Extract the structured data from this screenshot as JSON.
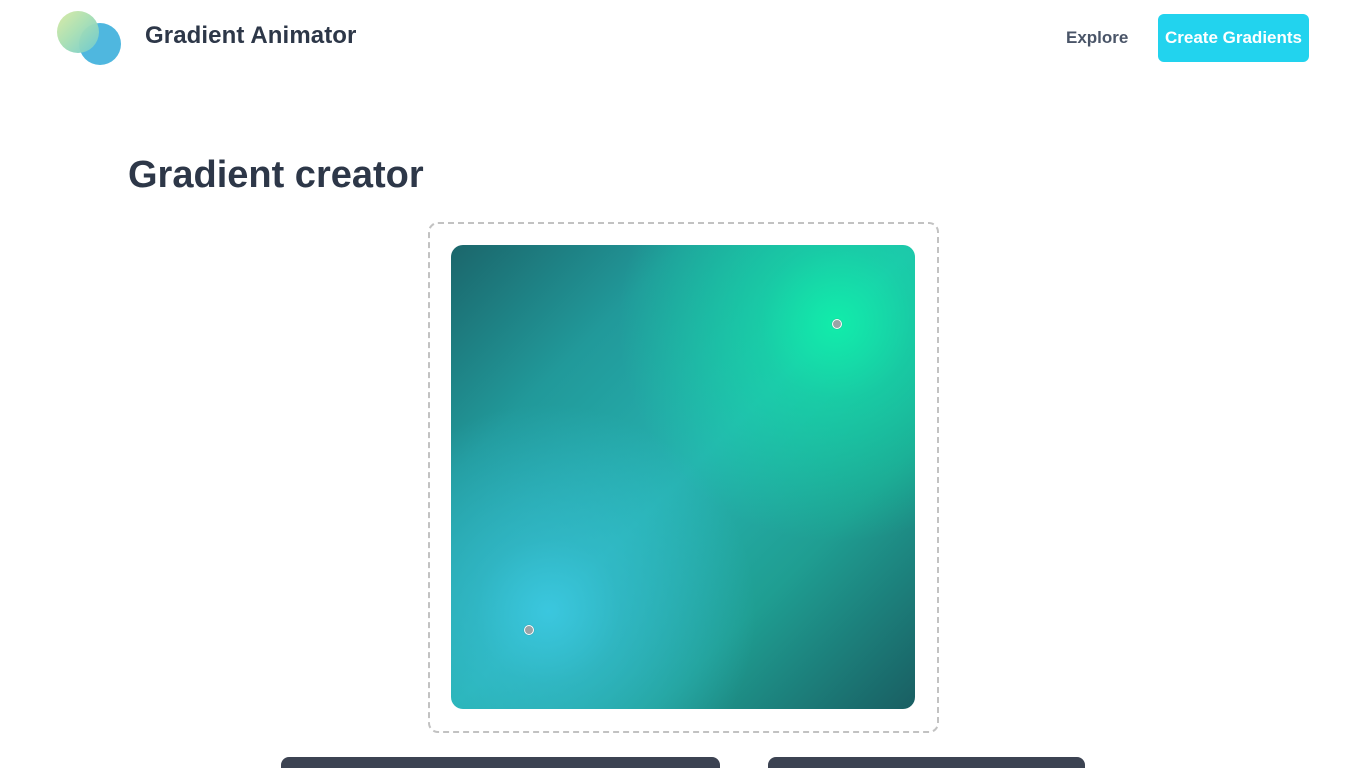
{
  "header": {
    "brand": "Gradient Animator",
    "nav": {
      "explore_label": "Explore",
      "cta_label": "Create Gradients"
    }
  },
  "main": {
    "title": "Gradient creator",
    "gradient": {
      "colors": {
        "corner_top_left": "#1b666b",
        "center": "#26b2af",
        "corner_bottom_right": "#195e62",
        "stop_top_right": "#10f0aa",
        "stop_bottom_left": "#3cc8e1"
      }
    }
  },
  "colors": {
    "accent": "#22d3ee",
    "text": "#2d3748",
    "panel": "#3c4352"
  }
}
